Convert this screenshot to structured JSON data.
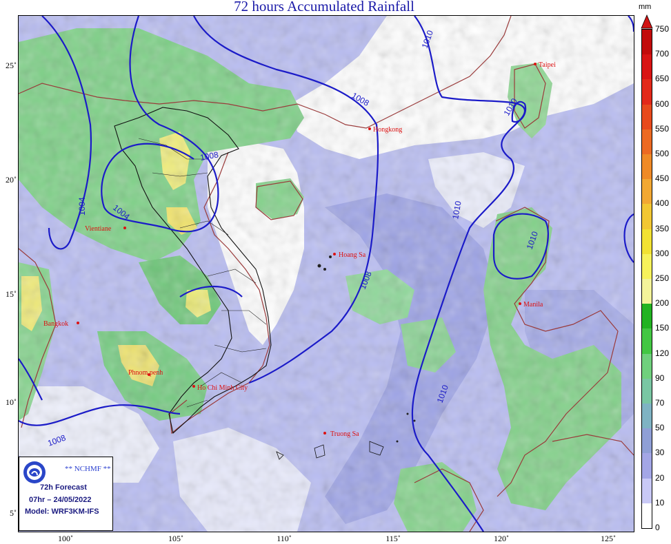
{
  "title": "72 hours Accumulated Rainfall",
  "colorbar": {
    "unit": "mm",
    "levels": [
      "0",
      "10",
      "20",
      "30",
      "50",
      "70",
      "90",
      "120",
      "150",
      "200",
      "250",
      "300",
      "350",
      "400",
      "450",
      "500",
      "550",
      "600",
      "650",
      "700",
      "750"
    ],
    "colors": [
      "#ffffff",
      "#c9c9f6",
      "#a3a6e6",
      "#8f9fd6",
      "#7fb3c3",
      "#79c6a3",
      "#6fd07d",
      "#43c743",
      "#22b322",
      "#f3f39a",
      "#f7f25b",
      "#f2e233",
      "#f2c733",
      "#f2a833",
      "#ef8a26",
      "#ec6a22",
      "#e84a1d",
      "#e3291a",
      "#d91414",
      "#c20b0b"
    ],
    "max_color": "#d01414"
  },
  "axes": {
    "lat_ticks": [
      "25˚",
      "20˚",
      "15˚",
      "10˚",
      "5˚"
    ],
    "lon_ticks": [
      "100˚",
      "105˚",
      "110˚",
      "115˚",
      "120˚",
      "125˚"
    ]
  },
  "cities": [
    {
      "name": "Taipei"
    },
    {
      "name": "Hongkong"
    },
    {
      "name": "Vientiane"
    },
    {
      "name": "Hoang Sa"
    },
    {
      "name": "Bangkok"
    },
    {
      "name": "Manila"
    },
    {
      "name": "Phnom penh"
    },
    {
      "name": "Ho Chi Minh City"
    },
    {
      "name": "Truong Sa"
    }
  ],
  "isobars": [
    {
      "label": "1010"
    },
    {
      "label": "1008"
    },
    {
      "label": "1004"
    },
    {
      "label": "1004"
    },
    {
      "label": "1008"
    },
    {
      "label": "1010"
    },
    {
      "label": "1010"
    },
    {
      "label": "1008"
    },
    {
      "label": "1010"
    },
    {
      "label": "1010"
    },
    {
      "label": "1008"
    }
  ],
  "info_box": {
    "agency": "** NCHMF **",
    "logo_text": "NCHMF",
    "forecast": "72h Forecast",
    "datetime": "07hr – 24/05/2022",
    "model": "Model: WRF3KM-IFS"
  },
  "colors": {
    "title": "#1a1aa8",
    "isobar": "#1b1bc8",
    "coastline": "#9a3a3a",
    "city": "#dd1111"
  }
}
